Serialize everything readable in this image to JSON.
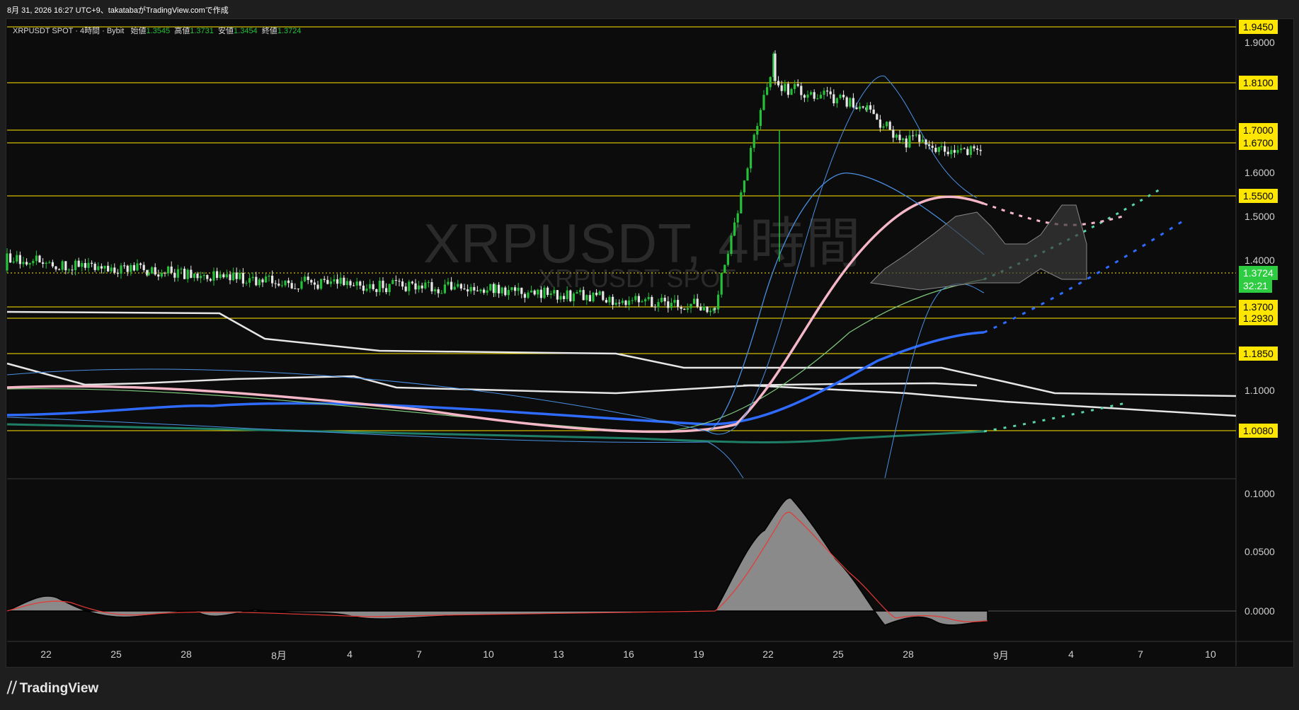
{
  "header": {
    "stamp": "8月 31, 2026 16:27 UTC+9、takatabaがTradingView.comで作成"
  },
  "symbol_bar": {
    "title": "XRPUSDT SPOT · 4時間 · Bybit",
    "open_label": "始値",
    "open": "1.3545",
    "high_label": "高値",
    "high": "1.3731",
    "low_label": "安値",
    "low": "1.3454",
    "close_label": "終値",
    "close": "1.3724"
  },
  "watermark": {
    "main": "XRPUSDT, 4時間",
    "sub": "XRPUSDT SPOT"
  },
  "price_axis": {
    "ticks": [
      "1.9000",
      "1.6000",
      "1.5000",
      "1.4000",
      "1.1000"
    ],
    "levels": [
      "1.9450",
      "1.8100",
      "1.7000",
      "1.6700",
      "1.5500",
      "1.3700",
      "1.2930",
      "1.1850",
      "1.0080"
    ],
    "current_price": "1.3724",
    "countdown": "32:21"
  },
  "osc_axis": {
    "ticks": [
      "0.1000",
      "0.0500",
      "0.0000"
    ]
  },
  "time_axis": {
    "labels": [
      "22",
      "25",
      "28",
      "8月",
      "4",
      "7",
      "10",
      "13",
      "16",
      "19",
      "22",
      "25",
      "28",
      "9月",
      "4",
      "7",
      "10"
    ]
  },
  "brand": {
    "name": "TradingView"
  },
  "colors": {
    "background": "#0c0c0c",
    "level_line": "#ffe600",
    "up_candle": "#25c03a",
    "down_candle": "#e6e6e6",
    "current_price": "#2ecc40",
    "bb_line": "#4a90e2",
    "ma_pink": "#f5b6c8",
    "ma_blue": "#2f6bff",
    "ma_white": "#e6e6e6",
    "ma_teal": "#58d6a3",
    "osc_area": "#8a8a8a",
    "osc_signal": "#e53935"
  }
}
